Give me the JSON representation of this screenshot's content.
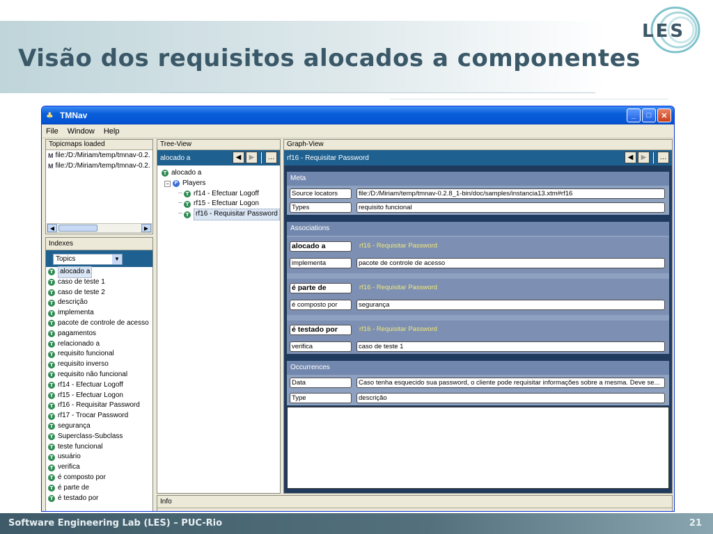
{
  "slide": {
    "title": "Visão dos requisitos alocados a componentes",
    "logo": "LES",
    "footer": "Software Engineering Lab (LES) – PUC-Rio",
    "page": "21"
  },
  "window": {
    "title": "TMNav",
    "menu": [
      "File",
      "Window",
      "Help"
    ],
    "buttons": {
      "minimize": "_",
      "maximize": "□",
      "close": "✕"
    }
  },
  "topicmaps": {
    "header": "Topicmaps loaded",
    "items": [
      "file:/D:/Miriam/temp/tmnav-0.2.",
      "file:/D:/Miriam/temp/tmnav-0.2."
    ]
  },
  "indexes": {
    "header": "Indexes",
    "dropdown": "Topics",
    "items": [
      "alocado a",
      "caso de teste 1",
      "caso de teste 2",
      "descrição",
      "implementa",
      "pacote de controle de acesso",
      "pagamentos",
      "relacionado a",
      "requisito funcional",
      "requisito inverso",
      "requisito não funcional",
      "rf14 - Efectuar Logoff",
      "rf15 - Efectuar Logon",
      "rf16 - Requisitar Password",
      "rf17 - Trocar Password",
      "segurança",
      "Superclass-Subclass",
      "teste funcional",
      "usuário",
      "verifica",
      "é composto por",
      "é parte de",
      "é testado por"
    ]
  },
  "tree": {
    "header": "Tree-View",
    "current": "alocado a",
    "root": "alocado a",
    "group": "Players",
    "children": [
      "rf14 - Efectuar Logoff",
      "rf15 - Efectuar Logon",
      "rf16 - Requisitar Password"
    ]
  },
  "graph": {
    "header": "Graph-View",
    "current": "rf16 - Requisitar Password",
    "meta": {
      "title": "Meta",
      "rows": [
        {
          "label": "Source locators",
          "value": "file:/D:/Miriam/temp/tmnav-0.2.8_1-bin/doc/samples/instancia13.xtm#rf16"
        },
        {
          "label": "Types",
          "value": "requisito funcional"
        }
      ]
    },
    "associations": {
      "title": "Associations",
      "groups": [
        {
          "type": "alocado a",
          "link": "rf16 - Requisitar Password",
          "role": "implementa",
          "value": "pacote de controle de acesso"
        },
        {
          "type": "é parte de",
          "link": "rf16 - Requisitar Password",
          "role": "é composto por",
          "value": "segurança"
        },
        {
          "type": "é testado por",
          "link": "rf16 - Requisitar Password",
          "role": "verifica",
          "value": "caso de teste 1"
        }
      ]
    },
    "occurrences": {
      "title": "Occurrences",
      "rows": [
        {
          "label": "Data",
          "value": "Caso tenha esquecido sua password, o cliente pode requisitar informações sobre a mesma. Deve se..."
        },
        {
          "label": "Type",
          "value": "descrição"
        }
      ]
    }
  },
  "info": {
    "header": "Info"
  }
}
